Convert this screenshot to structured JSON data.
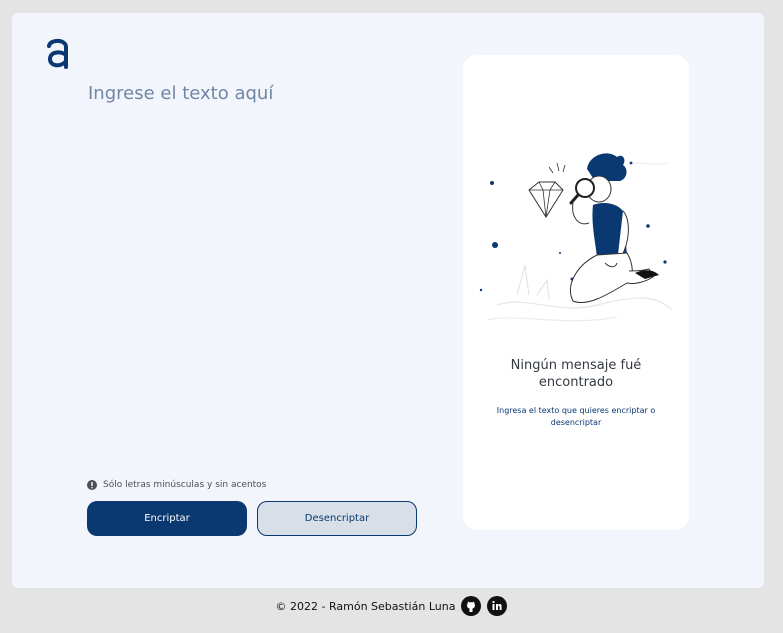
{
  "app": {
    "logo_letter": "a",
    "brand_color": "#0a3871"
  },
  "input": {
    "placeholder": "Ingrese el texto aquí",
    "value": ""
  },
  "hint": {
    "icon": "info-icon",
    "text": "Sólo letras minúsculas y sin acentos"
  },
  "buttons": {
    "encrypt_label": "Encriptar",
    "decrypt_label": "Desencriptar"
  },
  "output_panel": {
    "illustration": "person-with-magnifier-illustration",
    "title": "Ningún mensaje fué encontrado",
    "subtitle": "Ingresa el texto que quieres encriptar o desencriptar"
  },
  "footer": {
    "text": "© 2022 - Ramón Sebastián Luna",
    "icons": [
      "github-icon",
      "linkedin-icon"
    ]
  }
}
